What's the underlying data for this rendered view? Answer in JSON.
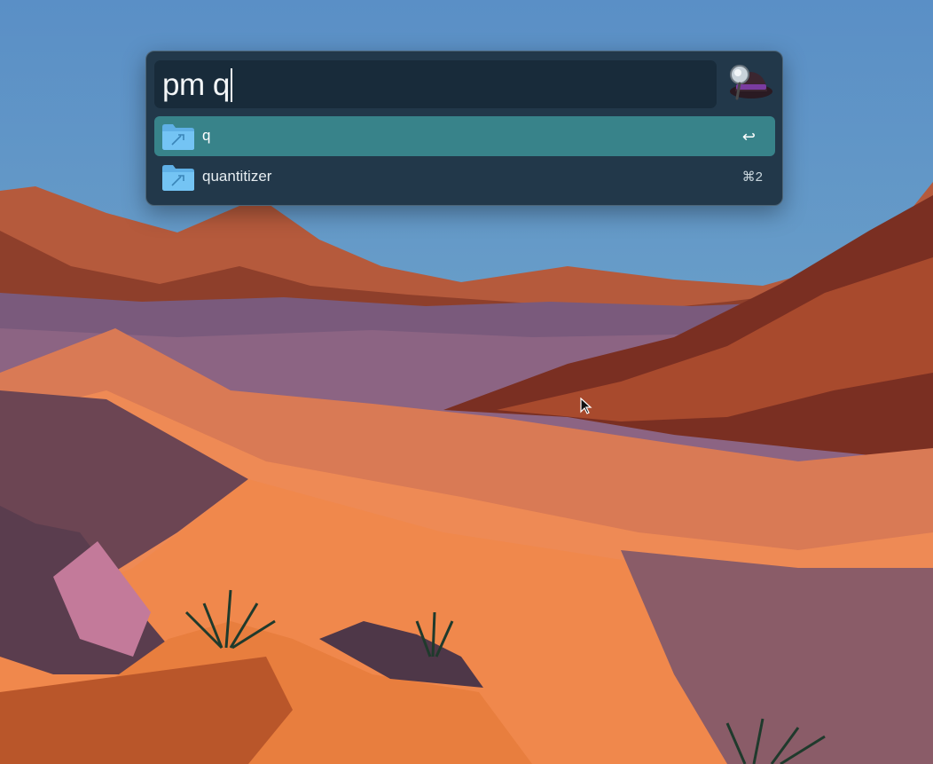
{
  "launcher": {
    "query": "pm q",
    "app_icon": "alfred-hat-icon",
    "results": [
      {
        "icon": "folder-icon",
        "label": "q",
        "shortcut": "↩",
        "selected": true
      },
      {
        "icon": "folder-icon",
        "label": "quantitizer",
        "shortcut": "⌘2",
        "selected": false
      }
    ]
  },
  "desktop": {
    "wallpaper": "desert-dunes-wallpaper",
    "cursor": "mouse-pointer-icon"
  },
  "colors": {
    "panel_bg": "#22384a",
    "search_bg": "#182b3a",
    "selection": "#38838a",
    "folder": "#6ec0f2"
  }
}
